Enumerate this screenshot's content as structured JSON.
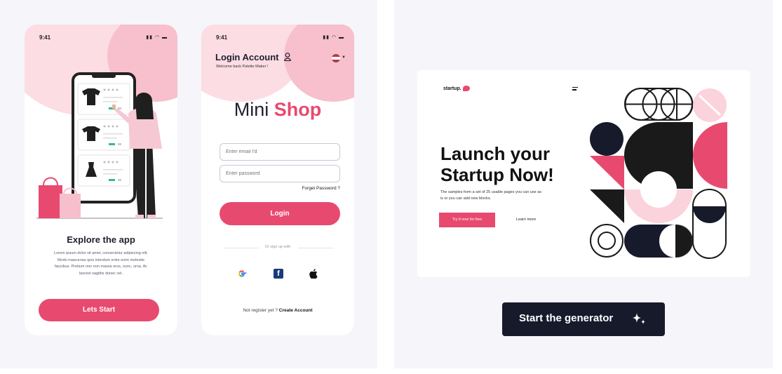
{
  "phone1": {
    "time": "9:41",
    "title": "Explore the app",
    "description": "Lorem ipsum dolor sit amet, consectetur adipiscing elit. Morbi maecenas quis interdum enim enim molestie faucibus. Pretium non non massa eros, nunc, urna. Ac laoreet sagittis donec vel.",
    "button": "Lets Start"
  },
  "phone2": {
    "time": "9:41",
    "title": "Login Account",
    "subtitle": "Welcome back Palette Maker !",
    "brand_first": "Mini",
    "brand_second": "Shop",
    "email_placeholder": "Enter email I'd",
    "password_placeholder": "Enter password",
    "forget": "Forget Password ?",
    "login": "Login",
    "or_text": "Or sign up with",
    "register_prefix": "Not register yet ?",
    "register_link": "Create Account"
  },
  "preview": {
    "logo": "startup.",
    "headline_line1": "Launch your",
    "headline_line2": "Startup Now!",
    "description": "The samples form a set of 25 usable pages you can use as is or you can add new blocks.",
    "try_button": "Try it now for free",
    "learn_more": "Learn more"
  },
  "generator_button": "Start the generator",
  "colors": {
    "accent": "#e84a6f",
    "pink_light": "#fbd3dc",
    "dark_navy": "#161a2b",
    "panel_bg": "#f5f5fa"
  },
  "icons": {
    "user": "user-icon",
    "flag": "flag-icon",
    "google": "google-icon",
    "facebook": "facebook-icon",
    "apple": "apple-icon",
    "sparkle": "sparkle-icon",
    "menu": "hamburger-menu-icon"
  }
}
